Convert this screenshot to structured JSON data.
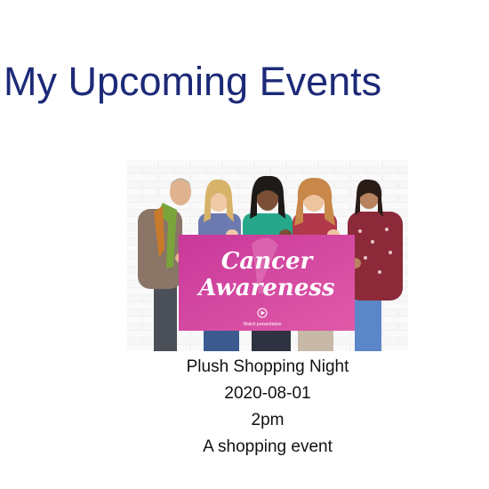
{
  "page": {
    "title": "My Upcoming Events"
  },
  "events": [
    {
      "image": {
        "sign_line1": "Cancer",
        "sign_line2": "Awareness",
        "sign_caption": "Watch presentation",
        "sign_color": "#d0409a",
        "icon": "play-circle-icon"
      },
      "name": "Plush Shopping Night",
      "date": "2020-08-01",
      "time": "2pm",
      "description": "A shopping event"
    }
  ],
  "colors": {
    "title": "#1d2a78",
    "text": "#111111",
    "background": "#ffffff"
  }
}
